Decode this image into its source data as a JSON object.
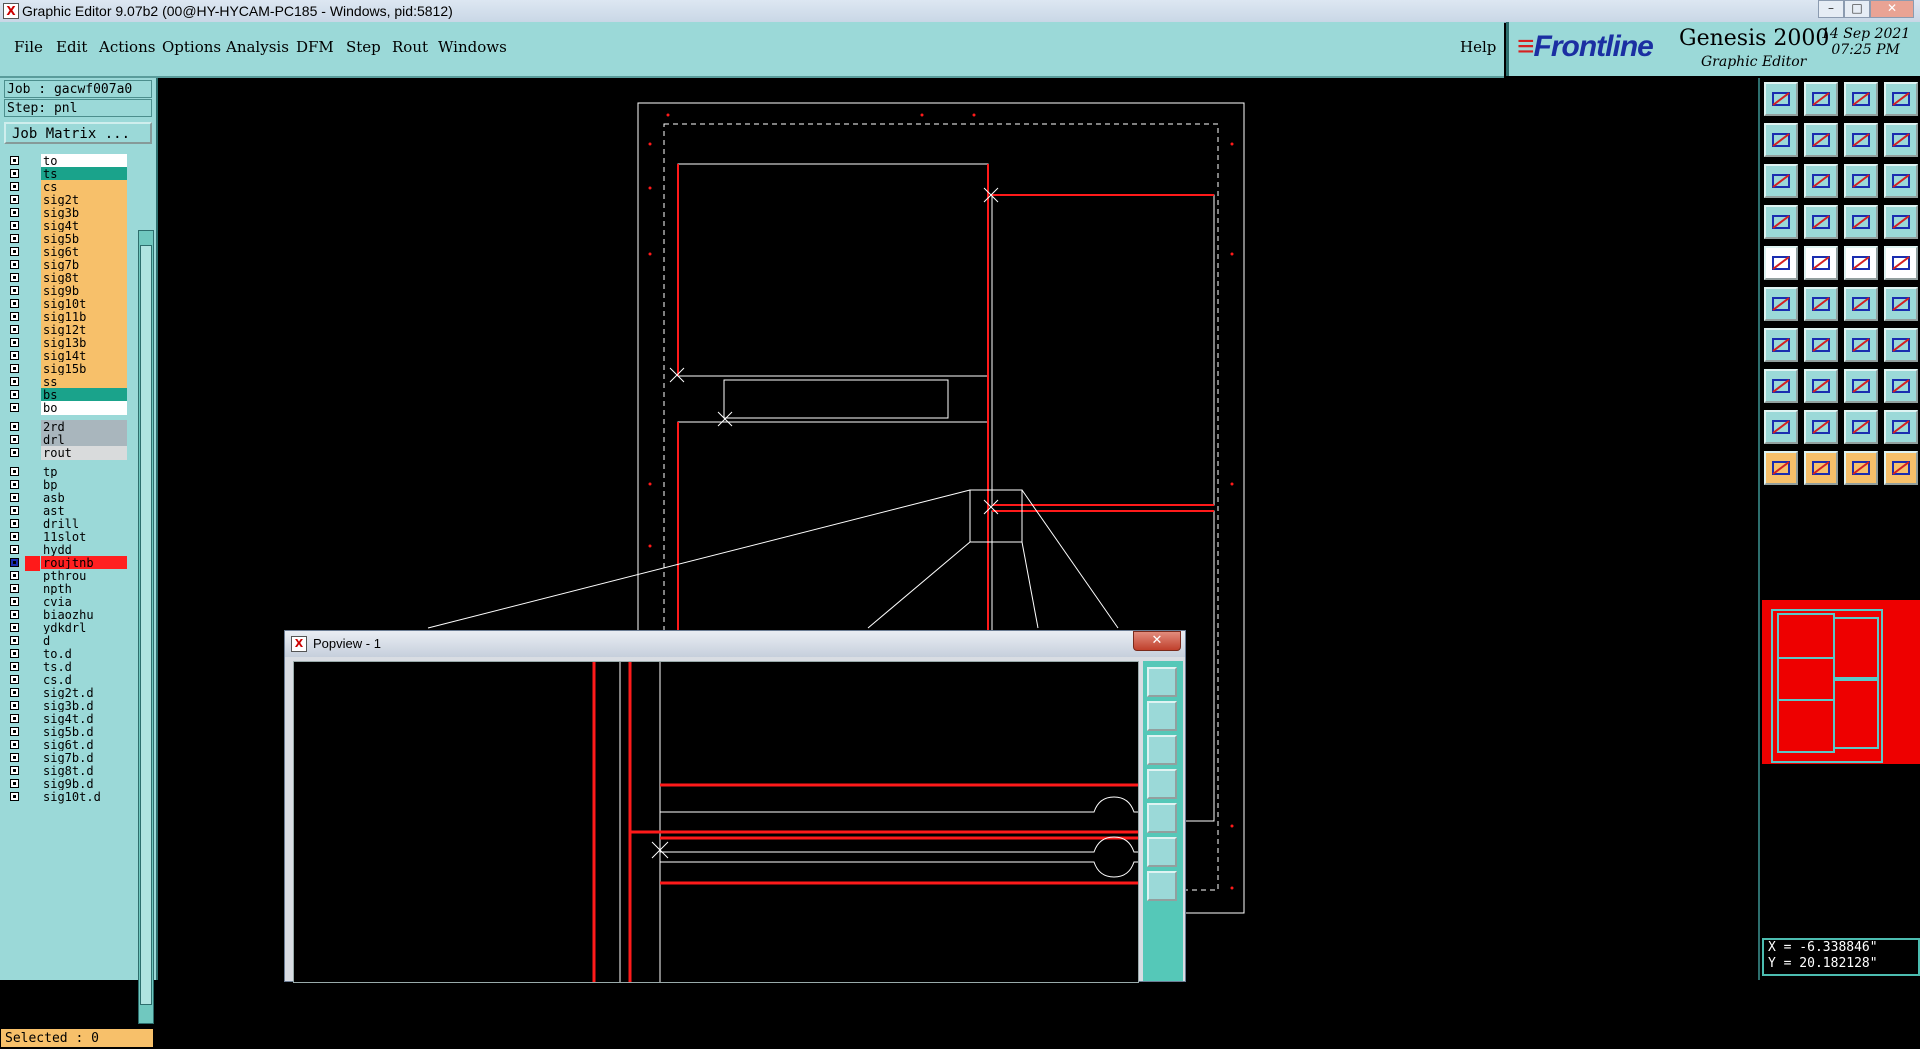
{
  "window": {
    "title": "Graphic Editor 9.07b2 (00@HY-HYCAM-PC185 - Windows, pid:5812)",
    "app_icon": "X"
  },
  "menu": {
    "items": [
      "File",
      "Edit",
      "Actions",
      "Options",
      "Analysis",
      "DFM",
      "Step",
      "Rout",
      "Windows"
    ],
    "help": "Help"
  },
  "brand": {
    "logo": "Frontline",
    "product": "Genesis 2000",
    "subtitle": "Graphic Editor",
    "date": "14 Sep 2021",
    "time": "07:25 PM"
  },
  "job": {
    "job_line": "Job : gacwf007a0",
    "step_line": "Step: pnl",
    "matrix_button": "Job Matrix ..."
  },
  "layers": [
    {
      "name": "to",
      "color": "#ffffff"
    },
    {
      "name": "ts",
      "color": "#1aa38b"
    },
    {
      "name": "cs",
      "color": "#f7c06a"
    },
    {
      "name": "sig2t",
      "color": "#f7c06a"
    },
    {
      "name": "sig3b",
      "color": "#f7c06a"
    },
    {
      "name": "sig4t",
      "color": "#f7c06a"
    },
    {
      "name": "sig5b",
      "color": "#f7c06a"
    },
    {
      "name": "sig6t",
      "color": "#f7c06a"
    },
    {
      "name": "sig7b",
      "color": "#f7c06a"
    },
    {
      "name": "sig8t",
      "color": "#f7c06a"
    },
    {
      "name": "sig9b",
      "color": "#f7c06a"
    },
    {
      "name": "sig10t",
      "color": "#f7c06a"
    },
    {
      "name": "sig11b",
      "color": "#f7c06a"
    },
    {
      "name": "sig12t",
      "color": "#f7c06a"
    },
    {
      "name": "sig13b",
      "color": "#f7c06a"
    },
    {
      "name": "sig14t",
      "color": "#f7c06a"
    },
    {
      "name": "sig15b",
      "color": "#f7c06a"
    },
    {
      "name": "ss",
      "color": "#f7c06a"
    },
    {
      "name": "bs",
      "color": "#1aa38b"
    },
    {
      "name": "bo",
      "color": "#ffffff"
    },
    {
      "name": "2rd",
      "color": "#a9b6bd",
      "gap": true
    },
    {
      "name": "drl",
      "color": "#a9b6bd"
    },
    {
      "name": "rout",
      "color": "#d9dbdc"
    },
    {
      "name": "tp",
      "color": "#9bd9d8",
      "gap": true
    },
    {
      "name": "bp",
      "color": "#9bd9d8"
    },
    {
      "name": "asb",
      "color": "#9bd9d8"
    },
    {
      "name": "ast",
      "color": "#9bd9d8"
    },
    {
      "name": "drill",
      "color": "#9bd9d8"
    },
    {
      "name": "11slot",
      "color": "#9bd9d8"
    },
    {
      "name": "hydd",
      "color": "#9bd9d8"
    },
    {
      "name": "roujtnb",
      "color": "#ff2020",
      "active": true
    },
    {
      "name": "pthrou",
      "color": "#9bd9d8"
    },
    {
      "name": "npth",
      "color": "#9bd9d8"
    },
    {
      "name": "cvia",
      "color": "#9bd9d8"
    },
    {
      "name": "biaozhu",
      "color": "#9bd9d8"
    },
    {
      "name": "ydkdrl",
      "color": "#9bd9d8"
    },
    {
      "name": "d",
      "color": "#9bd9d8"
    },
    {
      "name": "to.d",
      "color": "#9bd9d8"
    },
    {
      "name": "ts.d",
      "color": "#9bd9d8"
    },
    {
      "name": "cs.d",
      "color": "#9bd9d8"
    },
    {
      "name": "sig2t.d",
      "color": "#9bd9d8"
    },
    {
      "name": "sig3b.d",
      "color": "#9bd9d8"
    },
    {
      "name": "sig4t.d",
      "color": "#9bd9d8"
    },
    {
      "name": "sig5b.d",
      "color": "#9bd9d8"
    },
    {
      "name": "sig6t.d",
      "color": "#9bd9d8"
    },
    {
      "name": "sig7b.d",
      "color": "#9bd9d8"
    },
    {
      "name": "sig8t.d",
      "color": "#9bd9d8"
    },
    {
      "name": "sig9b.d",
      "color": "#9bd9d8"
    },
    {
      "name": "sig10t.d",
      "color": "#9bd9d8"
    }
  ],
  "status": {
    "selected": "Selected : 0"
  },
  "coords": {
    "x": "X = -6.338846\"",
    "y": "Y = 20.182128\""
  },
  "popview": {
    "title": "Popview - 1",
    "close": "✕"
  },
  "colors": {
    "panel": "#9bd9d8",
    "accent_red": "#ff1a1a",
    "highlight_orange": "#f7c06a"
  }
}
